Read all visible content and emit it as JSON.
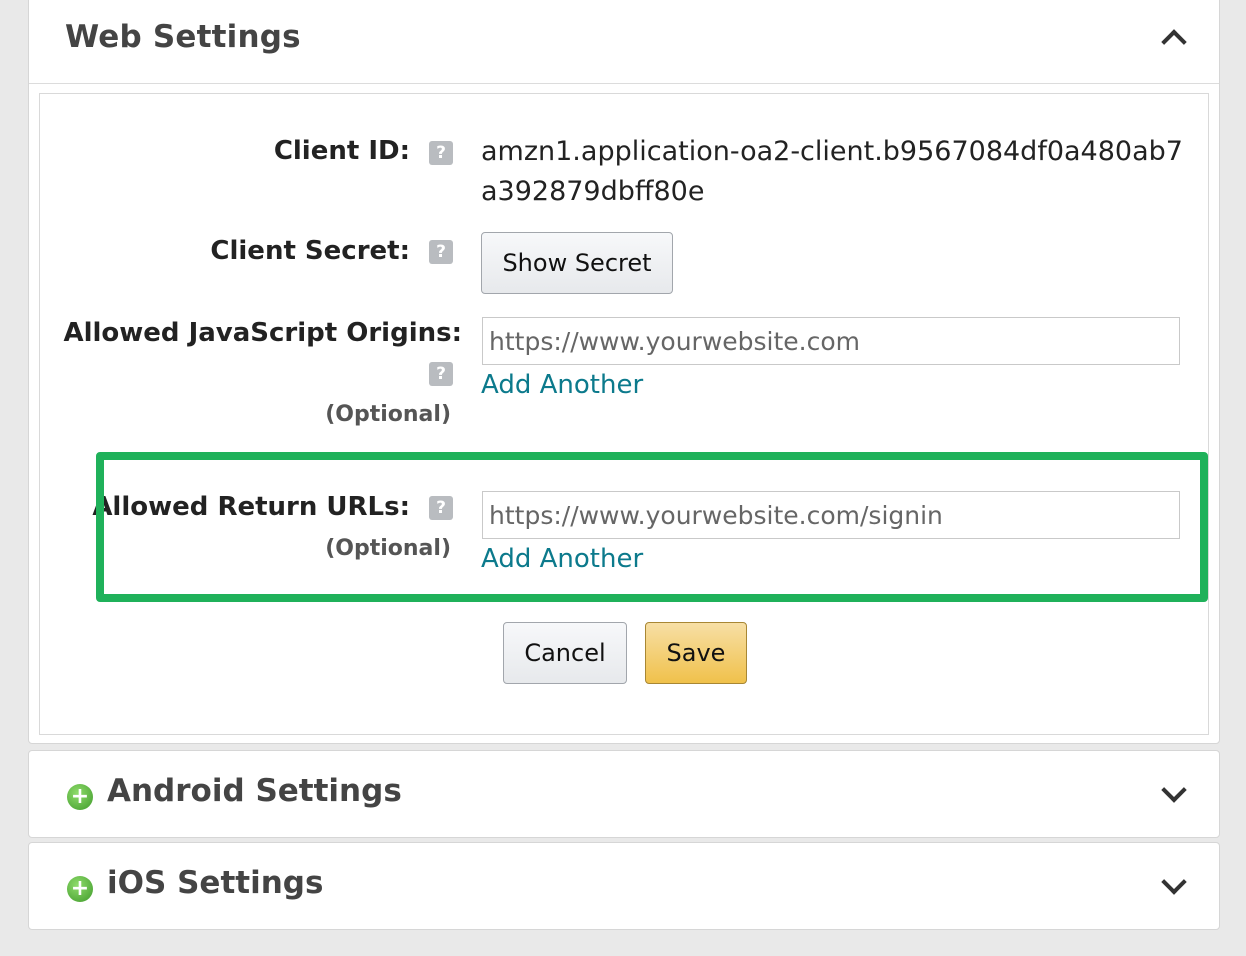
{
  "web_settings": {
    "title": "Web Settings",
    "client_id": {
      "label": "Client ID:",
      "value": "amzn1.application-oa2-client.b9567084df0a480ab7a392879dbff80e"
    },
    "client_secret": {
      "label": "Client Secret:",
      "button_label": "Show Secret"
    },
    "js_origins": {
      "label": "Allowed JavaScript Origins:",
      "optional": "(Optional)",
      "placeholder": "https://www.yourwebsite.com",
      "add_another": "Add Another"
    },
    "return_urls": {
      "label": "Allowed Return URLs:",
      "optional": "(Optional)",
      "placeholder": "https://www.yourwebsite.com/signin",
      "add_another": "Add Another"
    },
    "help_glyph": "?",
    "cancel_label": "Cancel",
    "save_label": "Save"
  },
  "android_settings": {
    "title": "Android Settings",
    "expand_glyph": "+"
  },
  "ios_settings": {
    "title": "iOS Settings",
    "expand_glyph": "+"
  },
  "colors": {
    "highlight": "#1fb15a",
    "link": "#0c7a8c",
    "primary_button": "#f0c14b"
  }
}
